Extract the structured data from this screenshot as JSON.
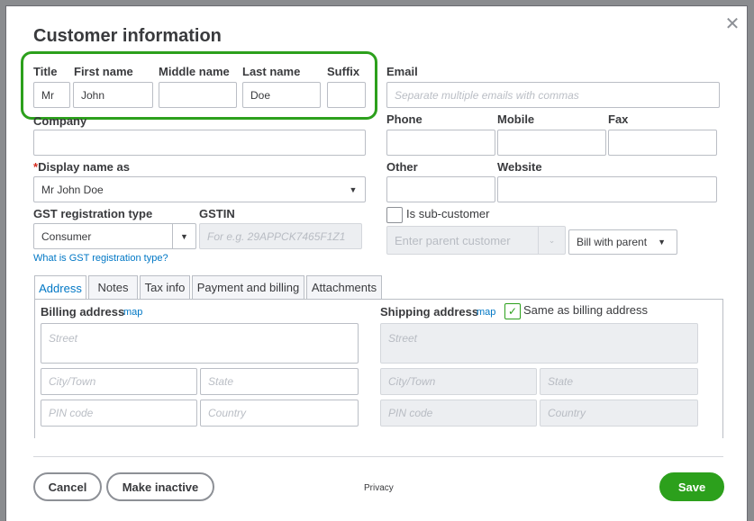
{
  "dialog": {
    "title": "Customer information",
    "close_icon": "close-icon"
  },
  "name": {
    "title_label": "Title",
    "title_value": "Mr",
    "first_label": "First name",
    "first_value": "John",
    "middle_label": "Middle name",
    "middle_value": "",
    "last_label": "Last name",
    "last_value": "Doe",
    "suffix_label": "Suffix",
    "suffix_value": ""
  },
  "company": {
    "label": "Company",
    "value": ""
  },
  "display_name": {
    "required_mark": "*",
    "label": "Display name as",
    "value": "Mr John  Doe"
  },
  "gst": {
    "type_label": "GST registration type",
    "type_value": "Consumer",
    "gstin_label": "GSTIN",
    "gstin_placeholder": "For e.g. 29APPCK7465F1Z1",
    "help_link": "What is GST registration type?"
  },
  "contact": {
    "email_label": "Email",
    "email_placeholder": "Separate multiple emails with commas",
    "phone_label": "Phone",
    "mobile_label": "Mobile",
    "fax_label": "Fax",
    "other_label": "Other",
    "website_label": "Website"
  },
  "subcustomer": {
    "label": "Is sub-customer",
    "checked": false,
    "parent_placeholder": "Enter parent customer",
    "bill_option": "Bill with parent"
  },
  "tabs": [
    {
      "label": "Address",
      "active": true
    },
    {
      "label": "Notes",
      "active": false
    },
    {
      "label": "Tax info",
      "active": false
    },
    {
      "label": "Payment and billing",
      "active": false
    },
    {
      "label": "Attachments",
      "active": false
    }
  ],
  "billing": {
    "title": "Billing address",
    "map_link": "map",
    "street": "Street",
    "city": "City/Town",
    "state": "State",
    "pin": "PIN code",
    "country": "Country"
  },
  "shipping": {
    "title": "Shipping address",
    "map_link": "map",
    "same_label": "Same as billing address",
    "same_checked": true,
    "street": "Street",
    "city": "City/Town",
    "state": "State",
    "pin": "PIN code",
    "country": "Country"
  },
  "footer": {
    "cancel": "Cancel",
    "make_inactive": "Make inactive",
    "privacy": "Privacy",
    "save": "Save"
  },
  "colors": {
    "accent_green": "#2ca01c",
    "link_blue": "#0077c5",
    "required_red": "#d52b1e"
  }
}
